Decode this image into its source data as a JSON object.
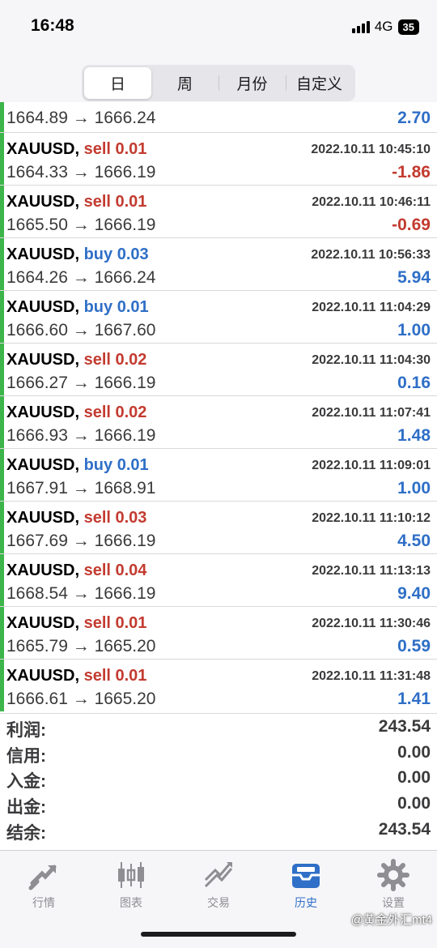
{
  "status": {
    "time": "16:48",
    "network": "4G",
    "battery": "35"
  },
  "segments": [
    {
      "label": "日",
      "active": true
    },
    {
      "label": "周",
      "active": false
    },
    {
      "label": "月份",
      "active": false
    },
    {
      "label": "自定义",
      "active": false
    }
  ],
  "top_partial": {
    "prices": "1664.89 → 1666.24",
    "profit": "2.70",
    "profit_sign": "pos"
  },
  "trades": [
    {
      "symbol": "XAUUSD,",
      "side": "sell",
      "side_label": "sell 0.01",
      "datetime": "2022.10.11 10:45:10",
      "prices": "1664.33 → 1666.19",
      "profit": "-1.86",
      "profit_sign": "neg"
    },
    {
      "symbol": "XAUUSD,",
      "side": "sell",
      "side_label": "sell 0.01",
      "datetime": "2022.10.11 10:46:11",
      "prices": "1665.50 → 1666.19",
      "profit": "-0.69",
      "profit_sign": "neg"
    },
    {
      "symbol": "XAUUSD,",
      "side": "buy",
      "side_label": "buy 0.03",
      "datetime": "2022.10.11 10:56:33",
      "prices": "1664.26 → 1666.24",
      "profit": "5.94",
      "profit_sign": "pos"
    },
    {
      "symbol": "XAUUSD,",
      "side": "buy",
      "side_label": "buy 0.01",
      "datetime": "2022.10.11 11:04:29",
      "prices": "1666.60 → 1667.60",
      "profit": "1.00",
      "profit_sign": "pos"
    },
    {
      "symbol": "XAUUSD,",
      "side": "sell",
      "side_label": "sell 0.02",
      "datetime": "2022.10.11 11:04:30",
      "prices": "1666.27 → 1666.19",
      "profit": "0.16",
      "profit_sign": "pos"
    },
    {
      "symbol": "XAUUSD,",
      "side": "sell",
      "side_label": "sell 0.02",
      "datetime": "2022.10.11 11:07:41",
      "prices": "1666.93 → 1666.19",
      "profit": "1.48",
      "profit_sign": "pos"
    },
    {
      "symbol": "XAUUSD,",
      "side": "buy",
      "side_label": "buy 0.01",
      "datetime": "2022.10.11 11:09:01",
      "prices": "1667.91 → 1668.91",
      "profit": "1.00",
      "profit_sign": "pos"
    },
    {
      "symbol": "XAUUSD,",
      "side": "sell",
      "side_label": "sell 0.03",
      "datetime": "2022.10.11 11:10:12",
      "prices": "1667.69 → 1666.19",
      "profit": "4.50",
      "profit_sign": "pos"
    },
    {
      "symbol": "XAUUSD,",
      "side": "sell",
      "side_label": "sell 0.04",
      "datetime": "2022.10.11 11:13:13",
      "prices": "1668.54 → 1666.19",
      "profit": "9.40",
      "profit_sign": "pos"
    },
    {
      "symbol": "XAUUSD,",
      "side": "sell",
      "side_label": "sell 0.01",
      "datetime": "2022.10.11 11:30:46",
      "prices": "1665.79 → 1665.20",
      "profit": "0.59",
      "profit_sign": "pos"
    },
    {
      "symbol": "XAUUSD,",
      "side": "sell",
      "side_label": "sell 0.01",
      "datetime": "2022.10.11 11:31:48",
      "prices": "1666.61 → 1665.20",
      "profit": "1.41",
      "profit_sign": "pos"
    }
  ],
  "summary": [
    {
      "label": "利润:",
      "value": "243.54"
    },
    {
      "label": "信用:",
      "value": "0.00"
    },
    {
      "label": "入金:",
      "value": "0.00"
    },
    {
      "label": "出金:",
      "value": "0.00"
    },
    {
      "label": "结余:",
      "value": "243.54"
    }
  ],
  "tabs": [
    {
      "label": "行情",
      "icon": "quotes-icon",
      "active": false
    },
    {
      "label": "图表",
      "icon": "chart-icon",
      "active": false
    },
    {
      "label": "交易",
      "icon": "trade-icon",
      "active": false
    },
    {
      "label": "历史",
      "icon": "history-icon",
      "active": true
    },
    {
      "label": "设置",
      "icon": "settings-icon",
      "active": false
    }
  ],
  "watermark": "@黄金外汇mt4",
  "colors": {
    "buy": "#2f6fc7",
    "sell": "#c33b30",
    "accent": "#3db54a",
    "active_tab": "#2f6fc7"
  }
}
